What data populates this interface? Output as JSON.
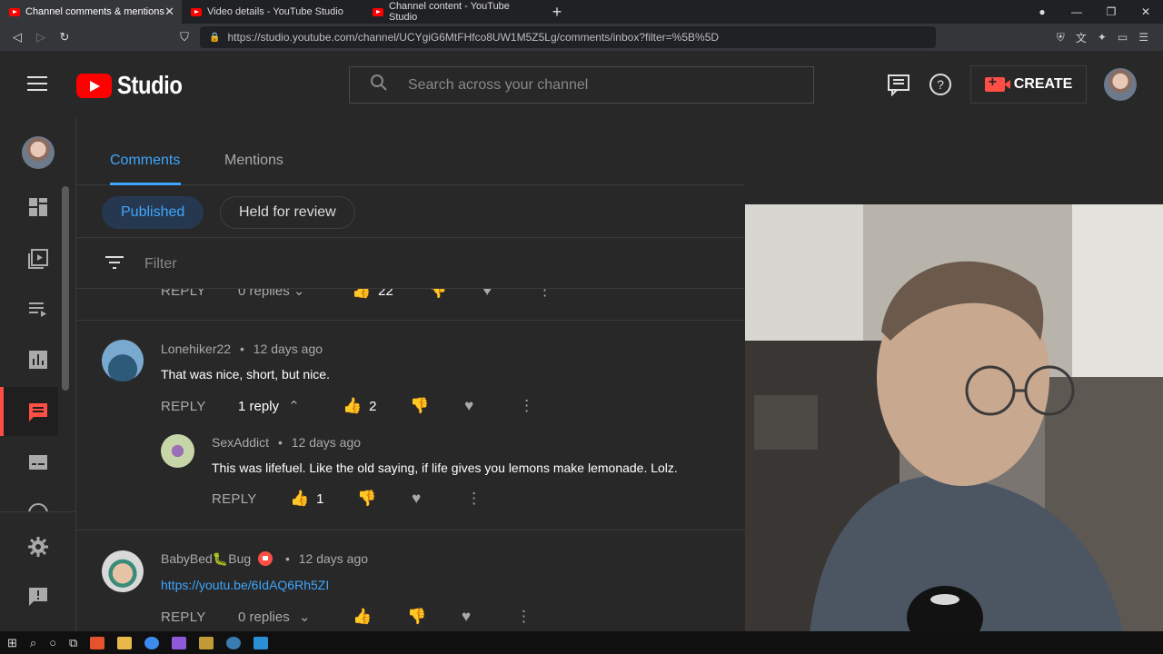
{
  "browser": {
    "tabs": [
      {
        "title": "Channel comments & mentions -"
      },
      {
        "title": "Video details - YouTube Studio"
      },
      {
        "title": "Channel content - YouTube Studio"
      }
    ],
    "new_tab": "+",
    "url": "https://studio.youtube.com/channel/UCYgiG6MtFHfco8UW1M5Z5Lg/comments/inbox?filter=%5B%5D"
  },
  "header": {
    "logo_text": "Studio",
    "search_placeholder": "Search across your channel",
    "create_label": "CREATE"
  },
  "tabs": [
    {
      "label": "Comments",
      "active": true
    },
    {
      "label": "Mentions",
      "active": false
    }
  ],
  "chips": [
    {
      "label": "Published",
      "active": true
    },
    {
      "label": "Held for review",
      "active": false
    }
  ],
  "filter_label": "Filter",
  "partial_row": {
    "reply": "REPLY",
    "replies": "0 replies",
    "likes": "22"
  },
  "comments": [
    {
      "author": "Lonehiker22",
      "time": "12 days ago",
      "text": "That was nice, short, but nice.",
      "reply_label": "REPLY",
      "replies": "1 reply",
      "likes": "2"
    },
    {
      "author": "SexAddict",
      "time": "12 days ago",
      "text": "This was lifefuel. Like the old saying, if life gives you lemons make lemonade. Lolz.",
      "reply_label": "REPLY",
      "likes": "1"
    },
    {
      "author": "BabyBed🐛Bug",
      "time": "12 days ago",
      "text": "https://youtu.be/6IdAQ6Rh5ZI",
      "reply_label": "REPLY",
      "replies": "0 replies"
    }
  ],
  "separator_dot": "•",
  "colors": {
    "accent": "#3ea6ff",
    "brand": "#ff0000",
    "create": "#ff4e45"
  }
}
